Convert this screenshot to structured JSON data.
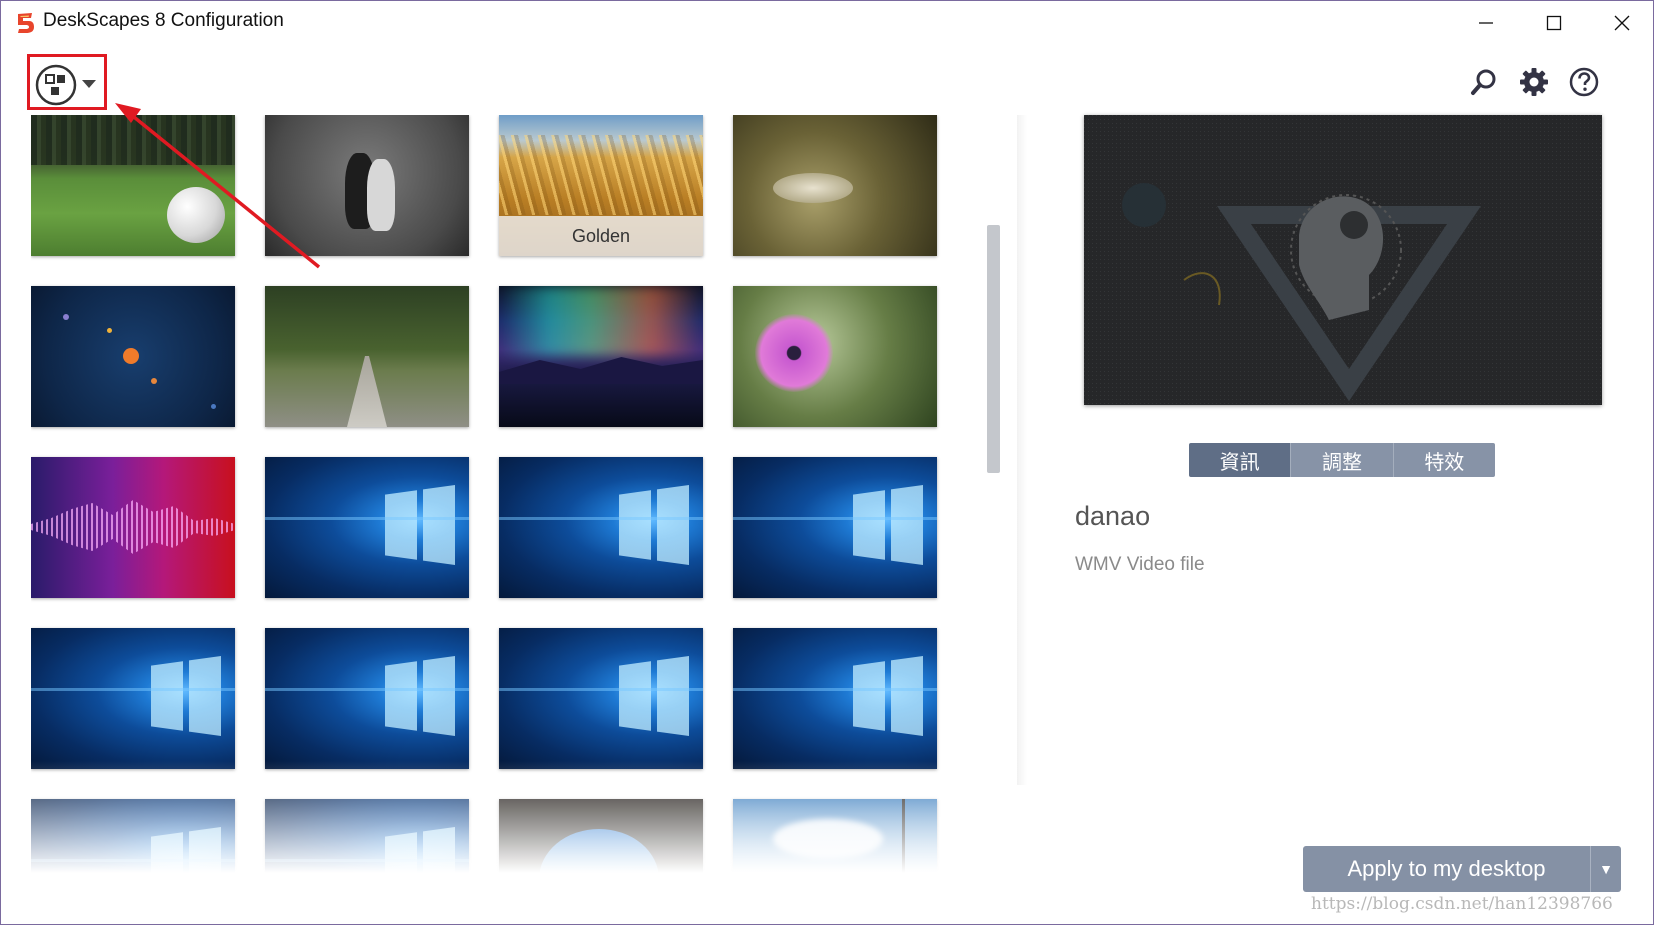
{
  "window": {
    "title": "DeskScapes 8 Configuration",
    "controls": [
      "minimize",
      "maximize",
      "close"
    ]
  },
  "toolbar": {
    "view_button": "view-options",
    "icons": [
      "search-icon",
      "gear-icon",
      "help-icon"
    ]
  },
  "thumbnails": [
    {
      "id": "golf",
      "caption": ""
    },
    {
      "id": "cats",
      "caption": ""
    },
    {
      "id": "golden",
      "caption": "Golden"
    },
    {
      "id": "grass",
      "caption": ""
    },
    {
      "id": "planets",
      "caption": ""
    },
    {
      "id": "tree-road",
      "caption": ""
    },
    {
      "id": "aurora",
      "caption": ""
    },
    {
      "id": "flower",
      "caption": ""
    },
    {
      "id": "soundwave",
      "caption": ""
    },
    {
      "id": "win10-a",
      "caption": ""
    },
    {
      "id": "win10-b",
      "caption": ""
    },
    {
      "id": "win10-c",
      "caption": ""
    },
    {
      "id": "win10-d",
      "caption": ""
    },
    {
      "id": "win10-e",
      "caption": ""
    },
    {
      "id": "win10-f",
      "caption": ""
    },
    {
      "id": "win10-g",
      "caption": ""
    },
    {
      "id": "win10-h",
      "caption": ""
    },
    {
      "id": "win10-i",
      "caption": ""
    },
    {
      "id": "cave",
      "caption": ""
    },
    {
      "id": "beach",
      "caption": ""
    }
  ],
  "detail": {
    "tabs": [
      {
        "label": "資訊",
        "active": true
      },
      {
        "label": "調整",
        "active": false
      },
      {
        "label": "特效",
        "active": false
      }
    ],
    "name": "danao",
    "file_type": "WMV Video file"
  },
  "apply": {
    "label": "Apply to my desktop",
    "dropdown_glyph": "▼"
  },
  "watermark": "https://blog.csdn.net/han12398766",
  "colors": {
    "highlight_box": "#e01a22",
    "tab_active": "#5f6e86",
    "tab_inactive": "#8793a7",
    "button": "#8591a5"
  }
}
